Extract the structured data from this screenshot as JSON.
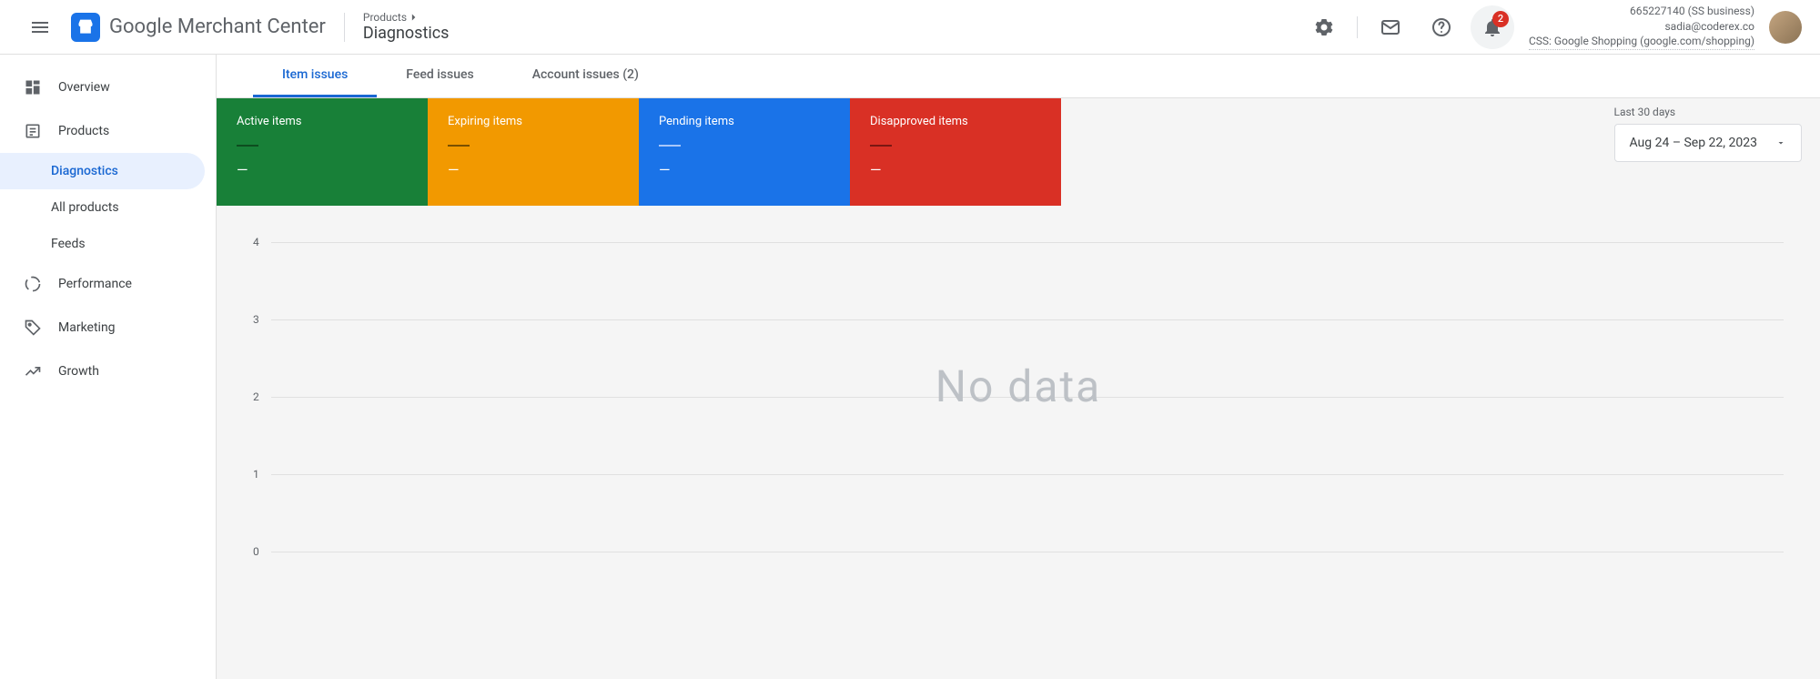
{
  "header": {
    "logo_text": "Google Merchant Center",
    "breadcrumb_parent": "Products",
    "page_title": "Diagnostics",
    "notification_count": "2",
    "account_id_line": "665227140 (SS business)",
    "account_email": "sadia@coderex.co",
    "css_line": "CSS: Google Shopping (google.com/shopping)"
  },
  "sidebar": {
    "overview": "Overview",
    "products": "Products",
    "diagnostics": "Diagnostics",
    "all_products": "All products",
    "feeds": "Feeds",
    "performance": "Performance",
    "marketing": "Marketing",
    "growth": "Growth"
  },
  "tabs": {
    "item_issues": "Item issues",
    "feed_issues": "Feed issues",
    "account_issues": "Account issues (2)"
  },
  "cards": {
    "active": {
      "title": "Active items",
      "value": "—"
    },
    "expiring": {
      "title": "Expiring items",
      "value": "—"
    },
    "pending": {
      "title": "Pending items",
      "value": "—"
    },
    "disapproved": {
      "title": "Disapproved items",
      "value": "—"
    }
  },
  "date": {
    "label": "Last 30 days",
    "range": "Aug 24 – Sep 22, 2023"
  },
  "chart_data": {
    "type": "line",
    "title": "",
    "xlabel": "",
    "ylabel": "",
    "ylim": [
      0,
      4
    ],
    "y_ticks": [
      0,
      1,
      2,
      3,
      4
    ],
    "series": [],
    "no_data_text": "No data"
  }
}
